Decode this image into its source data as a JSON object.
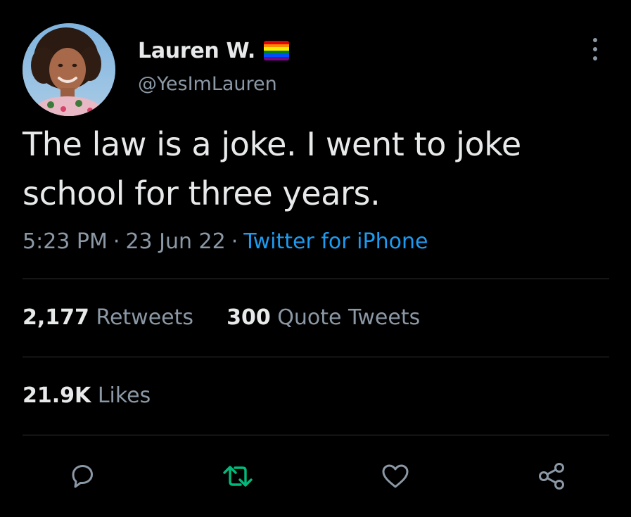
{
  "author": {
    "display_name": "Lauren W.",
    "handle": "@YesImLauren",
    "badge_icon": "rainbow-flag-icon",
    "flag_colors": [
      "#e40303",
      "#ff8c00",
      "#ffed00",
      "#008026",
      "#004dff",
      "#750787"
    ]
  },
  "tweet": {
    "text_line1": "The law is a joke. I went to joke",
    "text_line2": "school for three years.",
    "time": "5:23 PM",
    "separator": "·",
    "date": "23 Jun 22",
    "source": "Twitter for iPhone"
  },
  "stats": {
    "retweets_count": "2,177",
    "retweets_label": "Retweets",
    "quotes_count": "300",
    "quotes_label": "Quote Tweets",
    "likes_count": "21.9K",
    "likes_label": "Likes"
  },
  "actions": [
    {
      "icon": "reply-icon"
    },
    {
      "icon": "retweet-icon"
    },
    {
      "icon": "like-icon"
    },
    {
      "icon": "share-icon"
    }
  ],
  "colors": {
    "background": "#000000",
    "text_primary": "#e7e9ea",
    "text_secondary": "#8b98a5",
    "link": "#1d9bf0",
    "retweet_green": "#00ba7c",
    "divider": "#2f3336"
  }
}
